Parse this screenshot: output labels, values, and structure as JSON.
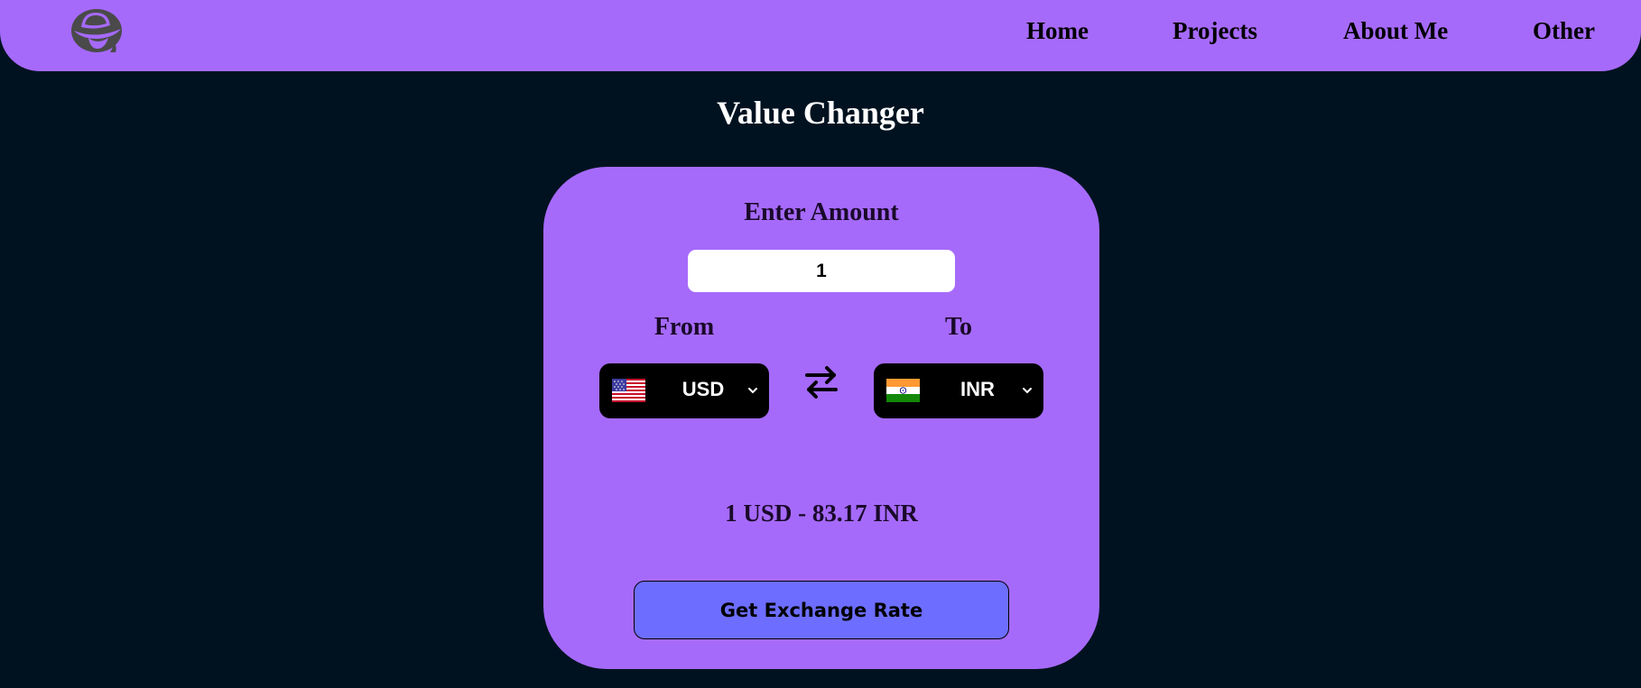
{
  "nav": {
    "logo_icon": "redhat-logo-icon",
    "links": [
      {
        "label": "Home"
      },
      {
        "label": "Projects"
      },
      {
        "label": "About Me"
      },
      {
        "label": "Other"
      }
    ]
  },
  "page": {
    "title": "Value Changer"
  },
  "converter": {
    "amount_label": "Enter Amount",
    "amount_value": "1",
    "from_label": "From",
    "to_label": "To",
    "from": {
      "code": "USD",
      "flag_icon": "us-flag-icon"
    },
    "to": {
      "code": "INR",
      "flag_icon": "india-flag-icon"
    },
    "swap_icon": "swap-arrows-icon",
    "result": "1 USD - 83.17 INR",
    "button_label": "Get Exchange Rate"
  },
  "colors": {
    "background": "#001220",
    "accent": "#a66afb",
    "button": "#6d6eff",
    "select_bg": "#000000"
  }
}
